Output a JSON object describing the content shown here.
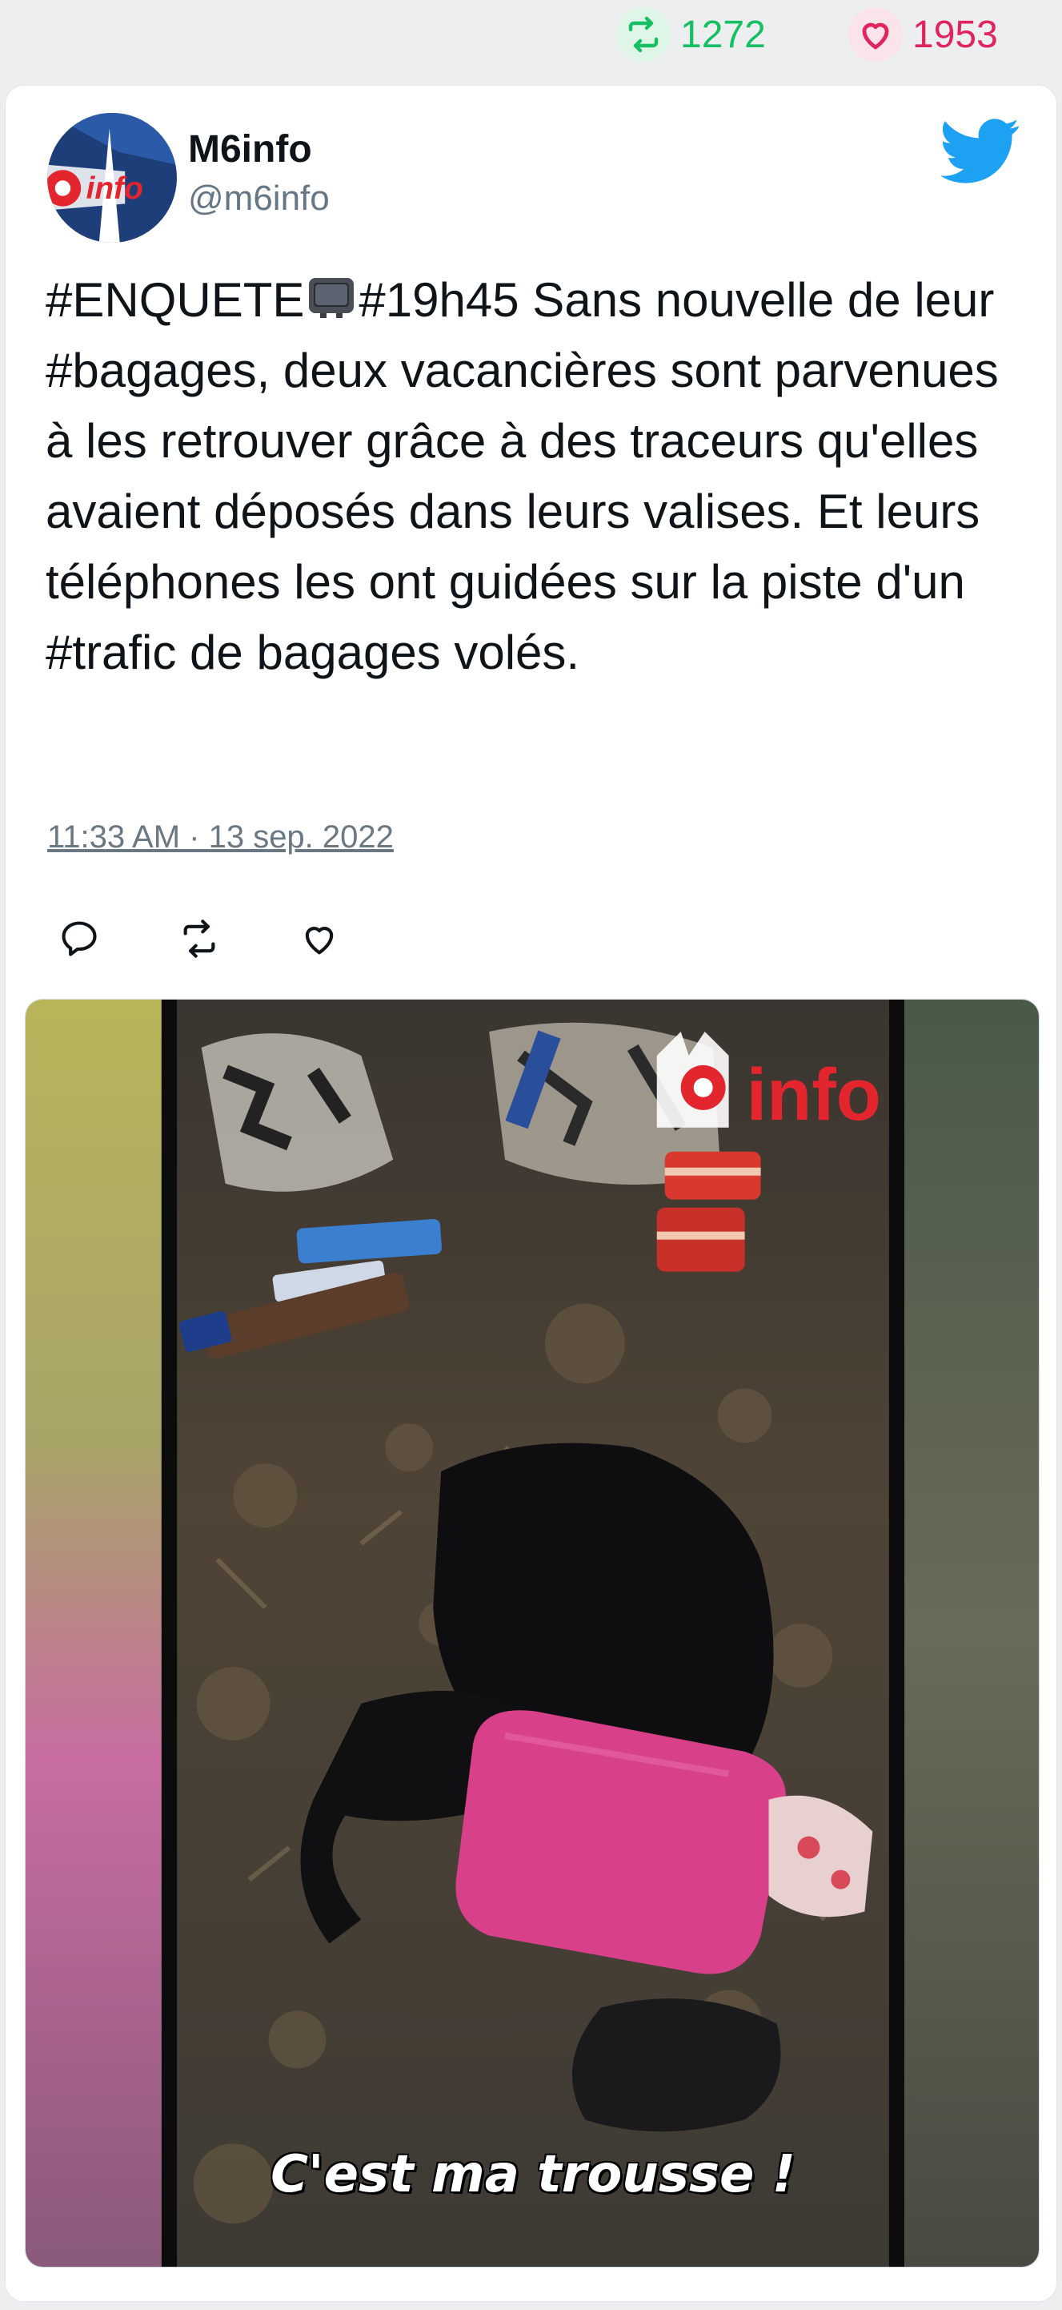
{
  "stats": {
    "retweet_count": "1272",
    "like_count": "1953"
  },
  "tweet": {
    "author_name": "M6info",
    "author_handle": "@m6info",
    "text_before_emoji": "#ENQUETE",
    "text_after_emoji": "#19h45 Sans nouvelle de leur #bagages, deux vacancières sont parvenues à les retrouver grâce à des traceurs qu'elles avaient déposés dans leurs valises. Et leurs téléphones les ont guidées sur la piste d'un #trafic de bagages volés.",
    "timestamp": "11:33 AM · 13 sep. 2022"
  },
  "media": {
    "caption": "C'est ma trousse !",
    "watermark_logo": "M6 info"
  },
  "icons": {
    "retweet": "retweet-icon",
    "like": "heart-icon",
    "reply": "reply-icon",
    "brand": "twitter-bird-icon",
    "emoji": "television-icon"
  },
  "colors": {
    "retweet_green": "#17bf63",
    "like_red": "#e0245e",
    "twitter_blue": "#1da1f2",
    "handle_gray": "#657786"
  }
}
